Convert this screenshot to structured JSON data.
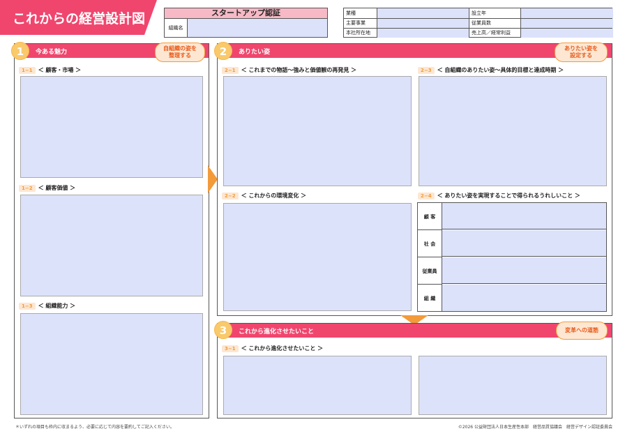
{
  "title": "これからの経営設計図",
  "certification": {
    "header": "スタートアップ認証",
    "org_label": "組織名",
    "org_value": ""
  },
  "info": {
    "industry_label": "業種",
    "industry_value": "",
    "founded_label": "設立年",
    "founded_value": "",
    "main_business_label": "主要事業",
    "main_business_value": "",
    "employees_label": "従業員数",
    "employees_value": "",
    "hq_label": "本社所在地",
    "hq_value": "",
    "sales_label": "売上高／経常利益",
    "sales_value": ""
  },
  "section1": {
    "number": "1",
    "title": "今ある魅力",
    "tag_line1": "自組織の姿を",
    "tag_line2": "整理する",
    "items": [
      {
        "num": "1−1",
        "label": "＜ 顧客・市場 ＞"
      },
      {
        "num": "1−2",
        "label": "＜ 顧客価値 ＞"
      },
      {
        "num": "1−3",
        "label": "＜ 組織能力 ＞"
      }
    ]
  },
  "section2": {
    "number": "2",
    "title": "ありたい姿",
    "tag_line1": "ありたい姿を",
    "tag_line2": "設定する",
    "items": [
      {
        "num": "2−1",
        "label": "＜ これまでの物語〜強みと価値観の再発見 ＞"
      },
      {
        "num": "2−2",
        "label": "＜ これからの環境変化 ＞"
      },
      {
        "num": "2−3",
        "label": "＜ 自組織のありたい姿〜具体的目標と達成時期 ＞"
      },
      {
        "num": "2−4",
        "label": "＜ ありたい姿を実現することで得られるうれしいこと ＞"
      }
    ],
    "rows": [
      "顧 客",
      "社 会",
      "従業員",
      "組 織"
    ]
  },
  "section3": {
    "number": "3",
    "title": "これから進化させたいこと",
    "tag": "変革への道筋",
    "items": [
      {
        "num": "3−1",
        "label": "＜ これから進化させたいこと ＞"
      }
    ]
  },
  "footer": {
    "note": "＊いずれの項目も枠内に収まるよう、必要に応じて内容を要約してご記入ください。",
    "copyright": "©2026 公益財団法人日本生産性本部　経営品質協議会　経営デザイン認証委員会"
  }
}
